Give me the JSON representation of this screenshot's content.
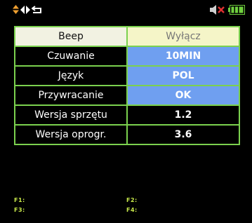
{
  "icons": {
    "nav": [
      "up-down-arrows-icon",
      "left-right-arrows-icon",
      "return-icon"
    ],
    "status": [
      "speaker-muted-icon",
      "battery-icon"
    ]
  },
  "colors": {
    "accent": "#f0a030",
    "border": "#7bd14e",
    "selected_bg": "#f5f5c8",
    "value_bg": "#6f9ff0",
    "fkey": "#c8e84a"
  },
  "settings": [
    {
      "label": "Beep",
      "value": "Wyłącz",
      "style": "light"
    },
    {
      "label": "Czuwanie",
      "value": "10MIN",
      "style": "blue"
    },
    {
      "label": "Język",
      "value": "POL",
      "style": "blue"
    },
    {
      "label": "Przywracanie",
      "value": "OK",
      "style": "blue"
    },
    {
      "label": "Wersja sprzętu",
      "value": "1.2",
      "style": "plain"
    },
    {
      "label": "Wersja oprogr.",
      "value": "3.6",
      "style": "plain"
    }
  ],
  "fkeys": {
    "f1": "F1:",
    "f2": "F2:",
    "f3": "F3:",
    "f4": "F4:"
  }
}
